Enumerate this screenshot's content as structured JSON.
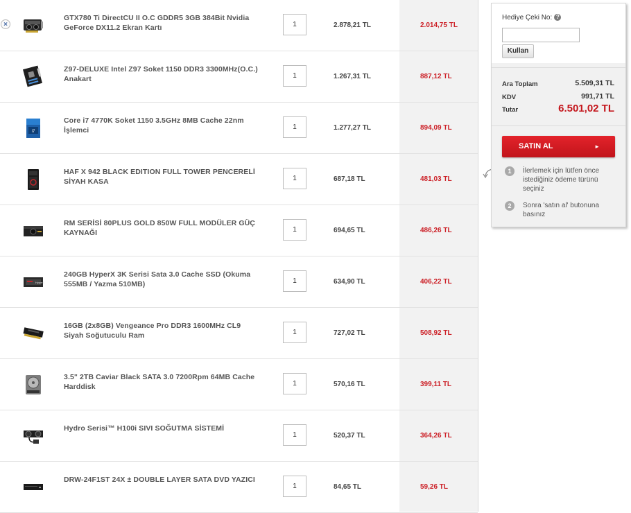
{
  "cart": {
    "items": [
      {
        "name": "GTX780 Ti DirectCU II O.C GDDR5 3GB 384Bit Nvidia GeForce DX11.2 Ekran Kartı",
        "qty": "1",
        "price": "2.878,21 TL",
        "discounted": "2.014,75 TL",
        "thumb": "graphics-card-icon"
      },
      {
        "name": "Z97-DELUXE Intel Z97 Soket 1150 DDR3 3300MHz(O.C.) Anakart",
        "qty": "1",
        "price": "1.267,31 TL",
        "discounted": "887,12 TL",
        "thumb": "motherboard-icon"
      },
      {
        "name": "Core i7 4770K Soket 1150 3.5GHz 8MB Cache 22nm İşlemci",
        "qty": "1",
        "price": "1.277,27 TL",
        "discounted": "894,09 TL",
        "thumb": "cpu-box-icon"
      },
      {
        "name": "HAF X 942 BLACK EDITION FULL TOWER PENCERELİ SİYAH KASA",
        "qty": "1",
        "price": "687,18 TL",
        "discounted": "481,03 TL",
        "thumb": "pc-case-icon"
      },
      {
        "name": "RM SERİSİ 80PLUS GOLD 850W FULL MODÜLER GÜÇ KAYNAĞI",
        "qty": "1",
        "price": "694,65 TL",
        "discounted": "486,26 TL",
        "thumb": "power-supply-icon"
      },
      {
        "name": "240GB HyperX 3K Serisi Sata 3.0 Cache SSD (Okuma 555MB / Yazma 510MB)",
        "qty": "1",
        "price": "634,90 TL",
        "discounted": "406,22 TL",
        "thumb": "ssd-icon"
      },
      {
        "name": "16GB (2x8GB) Vengeance Pro DDR3 1600MHz CL9 Siyah Soğutuculu Ram",
        "qty": "1",
        "price": "727,02 TL",
        "discounted": "508,92 TL",
        "thumb": "ram-icon"
      },
      {
        "name": "3.5\" 2TB Caviar Black SATA 3.0 7200Rpm 64MB Cache Harddisk",
        "qty": "1",
        "price": "570,16 TL",
        "discounted": "399,11 TL",
        "thumb": "hard-disk-icon"
      },
      {
        "name": "Hydro Serisi™ H100i SIVI SOĞUTMA SİSTEMİ",
        "qty": "1",
        "price": "520,37 TL",
        "discounted": "364,26 TL",
        "thumb": "liquid-cooler-icon"
      },
      {
        "name": "DRW-24F1ST 24X ± DOUBLE LAYER SATA DVD YAZICI",
        "qty": "1",
        "price": "84,65 TL",
        "discounted": "59,26 TL",
        "thumb": "dvd-drive-icon"
      }
    ],
    "remove_glyph": "×"
  },
  "summary": {
    "gift_label": "Hediye Çeki No:",
    "help_glyph": "?",
    "gift_value": "",
    "use_button": "Kullan",
    "subtotal_label": "Ara Toplam",
    "subtotal_value": "5.509,31 TL",
    "tax_label": "KDV",
    "tax_value": "991,71 TL",
    "total_label": "Tutar",
    "total_value": "6.501,02 TL",
    "buy_button": "SATIN AL",
    "buy_arrow": "►",
    "steps": [
      {
        "num": "1",
        "text": "İlerlemek için lütfen önce istediğiniz ödeme türünü seçiniz"
      },
      {
        "num": "2",
        "text": "Sonra 'satın al' butonuna basınız"
      }
    ],
    "colors": {
      "accent": "#c4161c",
      "button": "#d71920",
      "discount": "#cc2027"
    }
  }
}
